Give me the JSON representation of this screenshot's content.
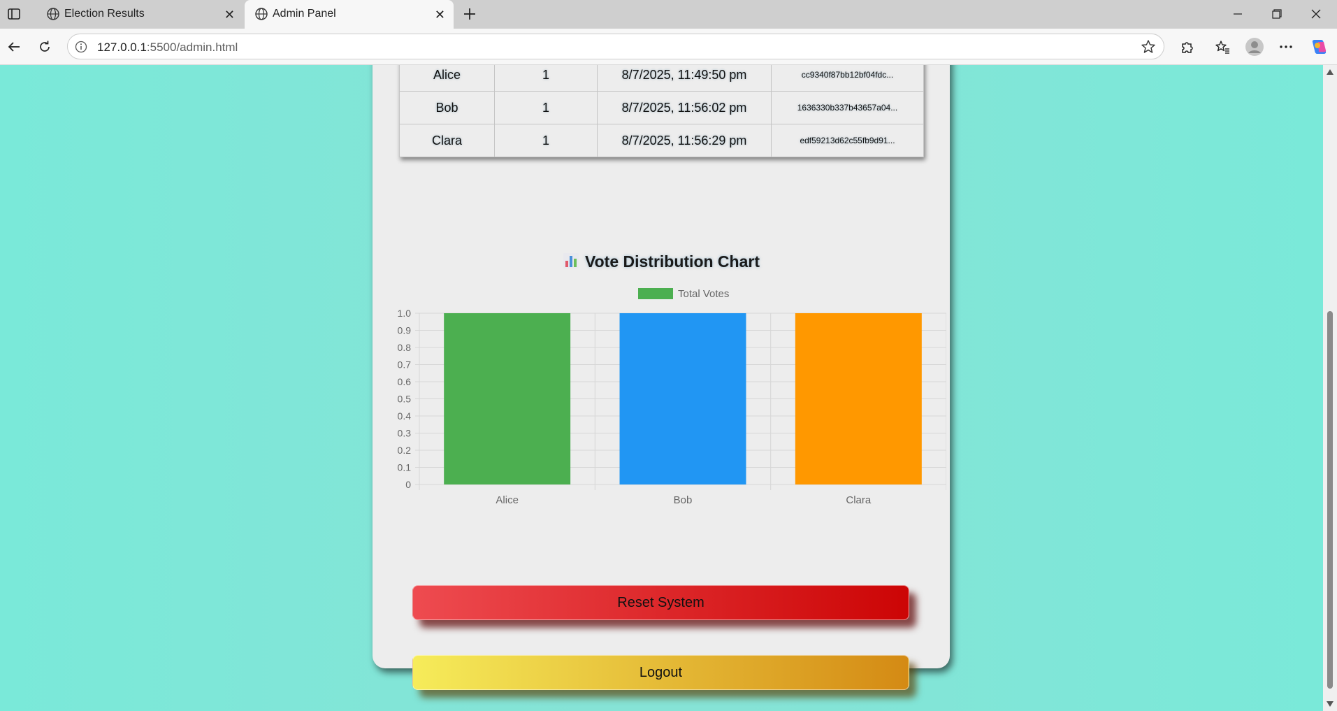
{
  "browser": {
    "tabs": [
      {
        "title": "Election Results",
        "active": false
      },
      {
        "title": "Admin Panel",
        "active": true
      }
    ],
    "url": {
      "host": "127.0.0.1",
      "path": ":5500/admin.html"
    }
  },
  "votes_table": {
    "rows": [
      {
        "candidate": "Alice",
        "votes": "1",
        "time": "8/7/2025, 11:49:50 pm",
        "hash": "cc9340f87bb12bf04fdc..."
      },
      {
        "candidate": "Bob",
        "votes": "1",
        "time": "8/7/2025, 11:56:02 pm",
        "hash": "1636330b337b43657a04..."
      },
      {
        "candidate": "Clara",
        "votes": "1",
        "time": "8/7/2025, 11:56:29 pm",
        "hash": "edf59213d62c55fb9d91..."
      }
    ]
  },
  "chart_section": {
    "title": "Vote Distribution Chart",
    "icon": "bar-chart-icon"
  },
  "chart_data": {
    "type": "bar",
    "categories": [
      "Alice",
      "Bob",
      "Clara"
    ],
    "series": [
      {
        "name": "Total Votes",
        "values": [
          1,
          1,
          1
        ]
      }
    ],
    "bar_colors": [
      "#4caf50",
      "#2196f3",
      "#ff9800"
    ],
    "legend_color": "#4caf50",
    "yticks": [
      "0",
      "0.1",
      "0.2",
      "0.3",
      "0.4",
      "0.5",
      "0.6",
      "0.7",
      "0.8",
      "0.9",
      "1.0"
    ],
    "ylim": [
      0,
      1
    ],
    "grid": true,
    "legend_position": "top"
  },
  "actions": {
    "reset_label": "Reset System",
    "logout_label": "Logout"
  },
  "colors": {
    "page_bg": "#7ae9d9",
    "panel_bg": "#ededed",
    "reset": "#e53935",
    "logout": "#e6c237"
  }
}
